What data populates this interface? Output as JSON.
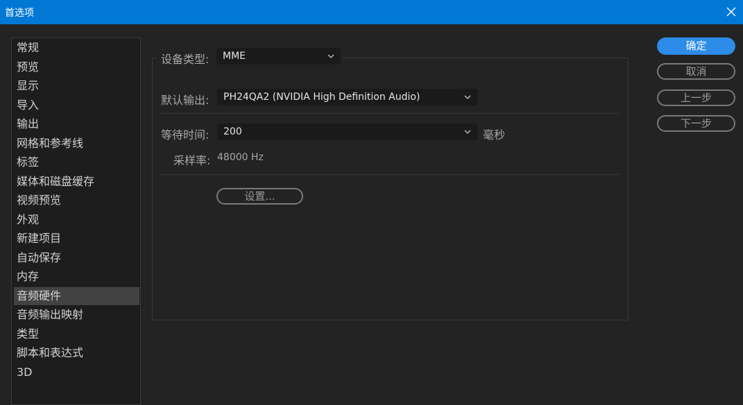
{
  "window": {
    "title": "首选项"
  },
  "sidebar": {
    "items": [
      {
        "label": "常规"
      },
      {
        "label": "预览"
      },
      {
        "label": "显示"
      },
      {
        "label": "导入"
      },
      {
        "label": "输出"
      },
      {
        "label": "网格和参考线"
      },
      {
        "label": "标签"
      },
      {
        "label": "媒体和磁盘缓存"
      },
      {
        "label": "视频预览"
      },
      {
        "label": "外观"
      },
      {
        "label": "新建项目"
      },
      {
        "label": "自动保存"
      },
      {
        "label": "内存"
      },
      {
        "label": "音频硬件",
        "active": true
      },
      {
        "label": "音频输出映射"
      },
      {
        "label": "类型"
      },
      {
        "label": "脚本和表达式"
      },
      {
        "label": "3D"
      }
    ]
  },
  "audio_hardware": {
    "device_type_label": "设备类型:",
    "device_type_value": "MME",
    "default_output_label": "默认输出:",
    "default_output_value": "PH24QA2 (NVIDIA High Definition Audio)",
    "latency_label": "等待时间:",
    "latency_value": "200",
    "latency_unit": "毫秒",
    "sample_rate_label": "采样率:",
    "sample_rate_value": "48000 Hz",
    "settings_button": "设置..."
  },
  "buttons": {
    "ok": "确定",
    "cancel": "取消",
    "previous": "上一步",
    "next": "下一步"
  },
  "colors": {
    "titlebar": "#0078d4",
    "primary": "#2c8ce8",
    "background": "#232323"
  }
}
